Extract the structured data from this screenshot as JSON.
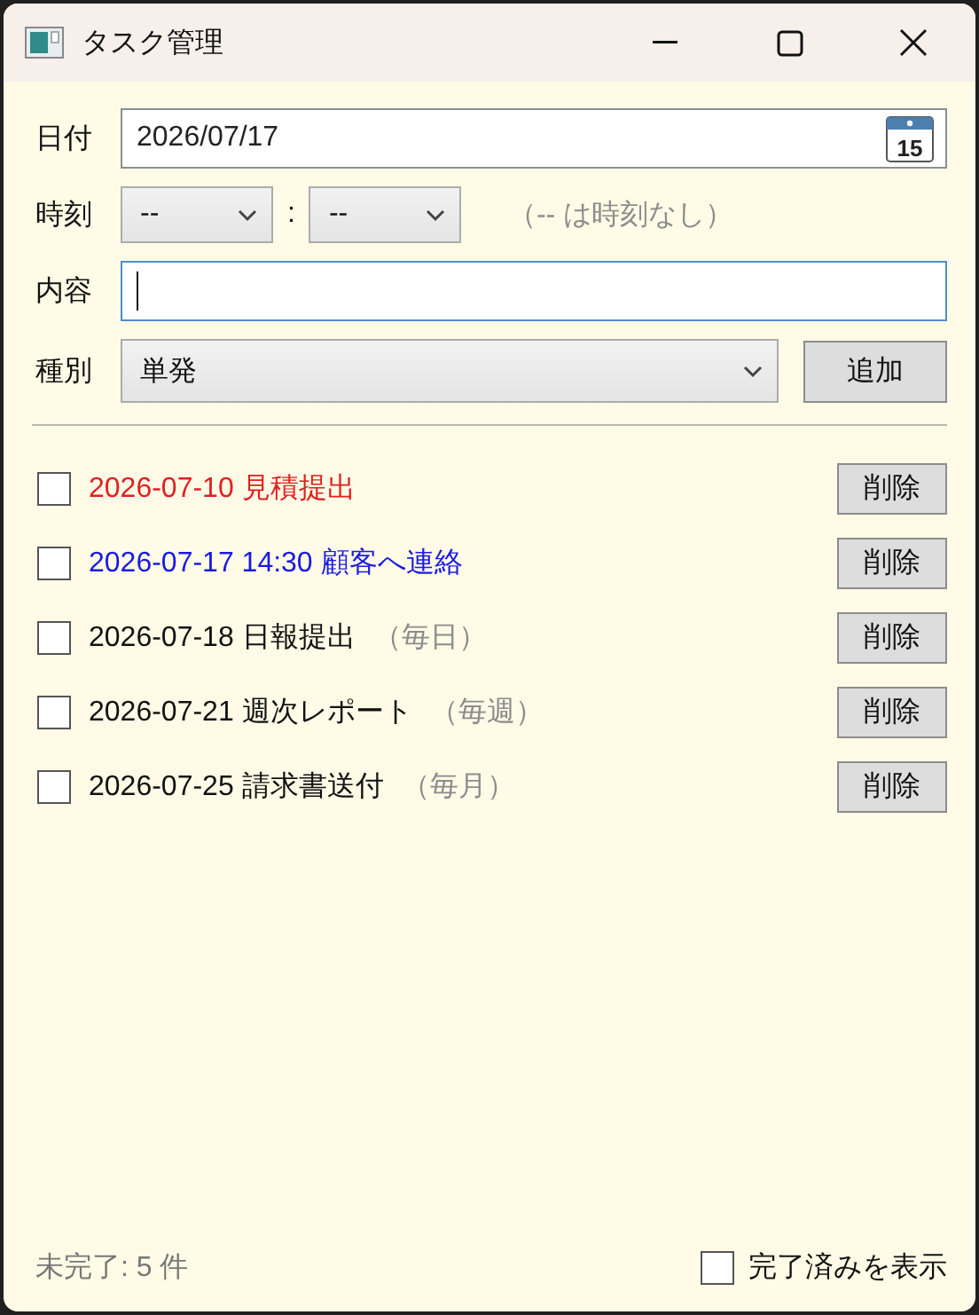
{
  "window": {
    "title": "タスク管理"
  },
  "form": {
    "date_label": "日付",
    "date_value": "2026/07/17",
    "calendar_day": "15",
    "time_label": "時刻",
    "hour": "--",
    "separator": ":",
    "minute": "--",
    "time_hint": "（-- は時刻なし）",
    "content_label": "内容",
    "content_focused": true,
    "kind_label": "種別",
    "kind_value": "単発",
    "add_button": "追加"
  },
  "tasks": [
    {
      "text": "2026-07-10 見積提出",
      "color": "#e02020",
      "checked": false,
      "delete_button": "削除"
    },
    {
      "text": "2026-07-17 14:30 顧客へ連絡",
      "color": "#1a1ae0",
      "checked": false,
      "delete_button": "削除"
    },
    {
      "text": "2026-07-18 日報提出",
      "recurrence": "（毎日）",
      "color": "#111111",
      "checked": false,
      "delete_button": "削除"
    },
    {
      "text": "2026-07-21 週次レポート",
      "recurrence": "（毎週）",
      "color": "#111111",
      "checked": false,
      "delete_button": "削除"
    },
    {
      "text": "2026-07-25 請求書送付",
      "recurrence": "（毎月）",
      "color": "#111111",
      "checked": false,
      "delete_button": "削除"
    }
  ],
  "status_bar": {
    "remaining": "未完了: 5 件",
    "show_done_label": "完了済みを表示",
    "show_done_checked": false
  }
}
